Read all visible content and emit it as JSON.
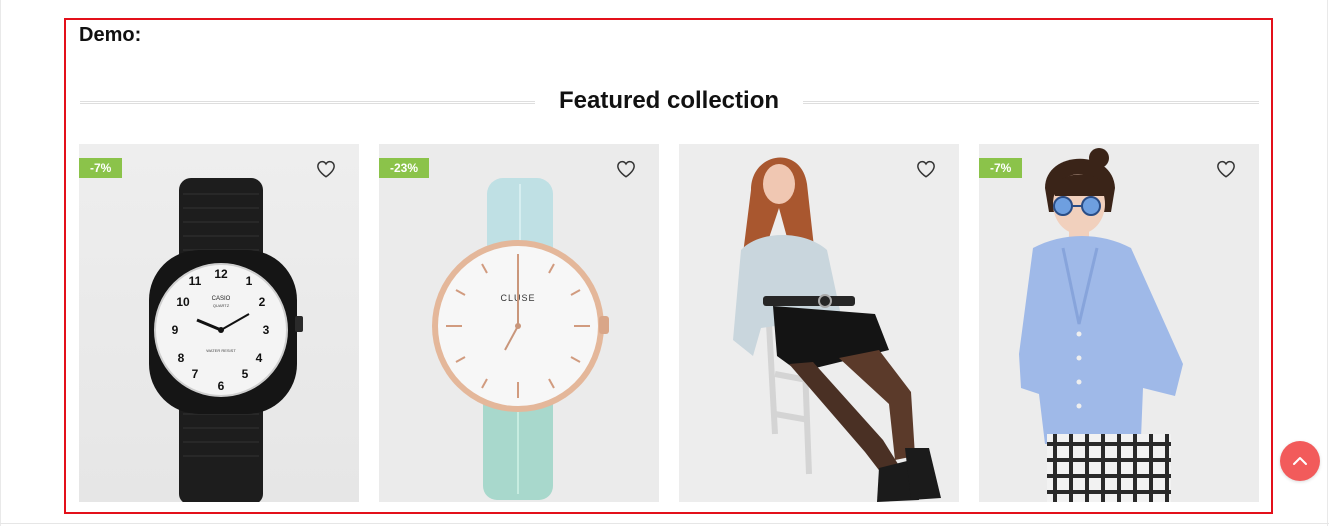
{
  "demo_label": "Demo:",
  "section_title": "Featured collection",
  "products": [
    {
      "name": "Black Casio watch",
      "badge": "-7%",
      "brand_text": "CASIO",
      "sub_text": "QUARTZ",
      "dial_text": "WATER RESIST"
    },
    {
      "name": "Cluse watch with mint leather strap",
      "badge": "-23%",
      "brand_text": "CLUSE"
    },
    {
      "name": "Woman in grey sweater and denim shorts",
      "badge": ""
    },
    {
      "name": "Woman in blue cardigan and sunglasses",
      "badge": "-7%"
    }
  ],
  "colors": {
    "frame": "#e3101a",
    "badge": "#8bc34a",
    "back_to_top": "#f25b5b",
    "card_bg": "#ebebeb"
  },
  "icons": {
    "wishlist": "heart-outline-icon",
    "back_to_top": "chevron-up-icon"
  }
}
